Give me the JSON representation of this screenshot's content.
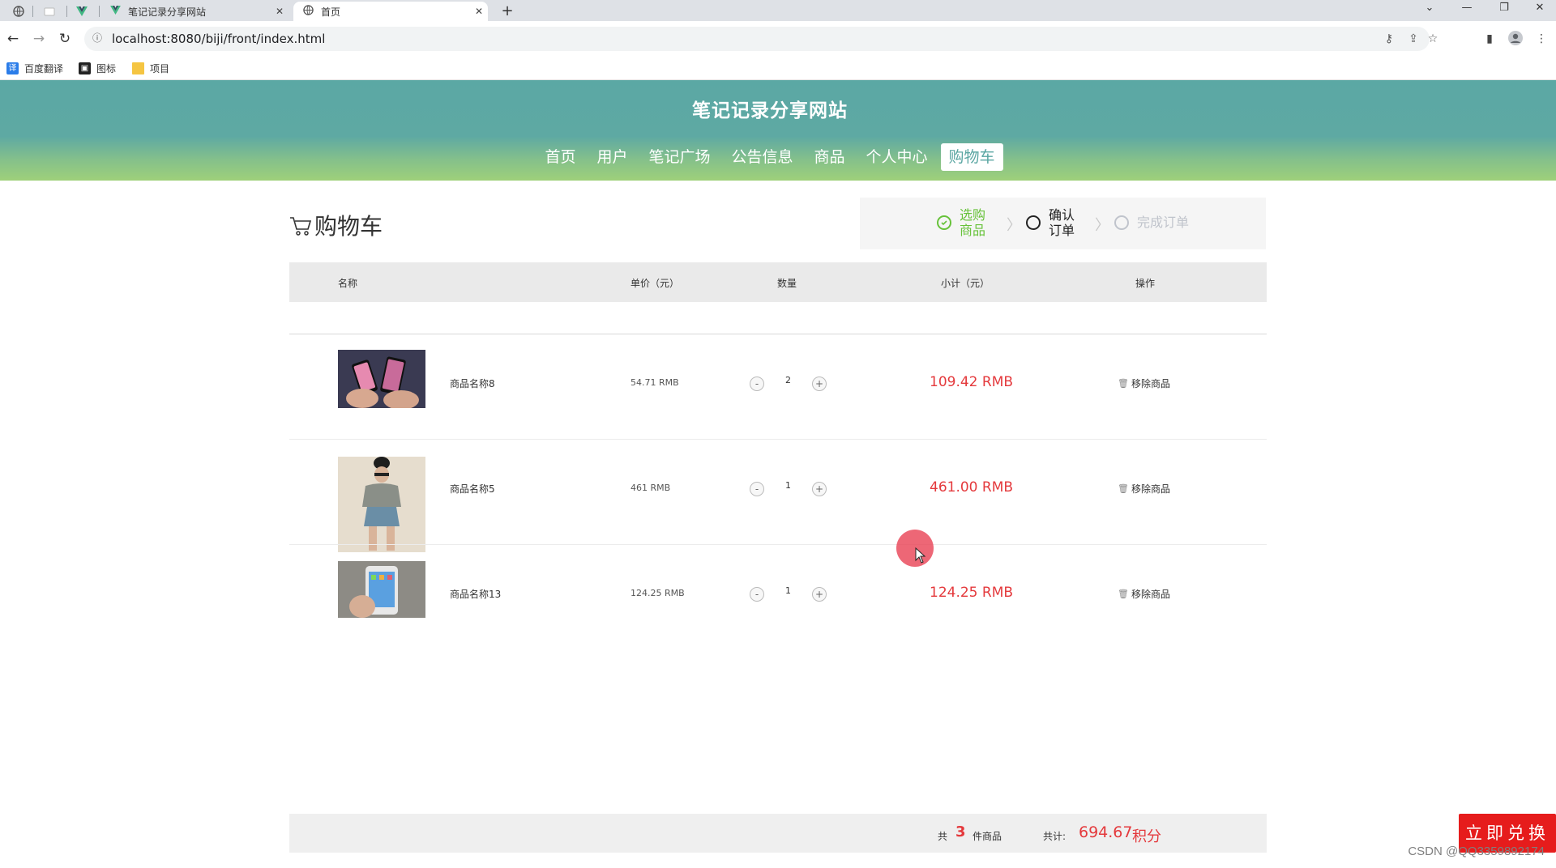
{
  "browser": {
    "tabs": [
      {
        "title": "笔记记录分享网站",
        "icon": "vue-logo-icon",
        "active": false
      },
      {
        "title": "首页",
        "icon": "globe-icon",
        "active": true
      }
    ],
    "url": "localhost:8080/biji/front/index.html",
    "bookmarks": [
      {
        "label": "百度翻译",
        "icon": "translate-icon"
      },
      {
        "label": "图标",
        "icon": "image-icon"
      },
      {
        "label": "项目",
        "icon": "folder-icon"
      }
    ]
  },
  "site": {
    "title": "笔记记录分享网站",
    "nav": [
      "首页",
      "用户",
      "笔记广场",
      "公告信息",
      "商品",
      "个人中心",
      "购物车"
    ],
    "active_nav": "购物车"
  },
  "cart": {
    "title": "购物车",
    "steps": [
      {
        "label": "选购商品",
        "line1": "选购",
        "line2": "商品",
        "state": "done"
      },
      {
        "label": "确认订单",
        "line1": "确认",
        "line2": "订单",
        "state": "current"
      },
      {
        "label": "完成订单",
        "state": "pending"
      }
    ],
    "columns": {
      "name": "名称",
      "price": "单价（元）",
      "qty": "数量",
      "subtotal": "小计（元）",
      "action": "操作"
    },
    "items": [
      {
        "name": "商品名称8",
        "price": "54.71 RMB",
        "qty": "2",
        "subtotal": "109.42 RMB",
        "remove": "移除商品",
        "image": "phones-in-hands"
      },
      {
        "name": "商品名称5",
        "price": "461 RMB",
        "qty": "1",
        "subtotal": "461.00 RMB",
        "remove": "移除商品",
        "image": "woman-fashion"
      },
      {
        "name": "商品名称13",
        "price": "124.25 RMB",
        "qty": "1",
        "subtotal": "124.25 RMB",
        "remove": "移除商品",
        "image": "phone-in-hand"
      }
    ],
    "qty_minus": "-",
    "qty_plus": "+",
    "footer": {
      "count_prefix": "共",
      "count": "3",
      "count_suffix": "件商品",
      "total_label": "共计:",
      "total": "694.67",
      "total_unit": "积分",
      "submit": "立即兑换"
    }
  },
  "watermark": "CSDN @QQ3359892174",
  "colors": {
    "header": "#5ba8a4",
    "header_bottom": "#9ed07a",
    "price_red": "#e4393c",
    "button_red": "#e61c1c",
    "step_done": "#67c23a"
  }
}
